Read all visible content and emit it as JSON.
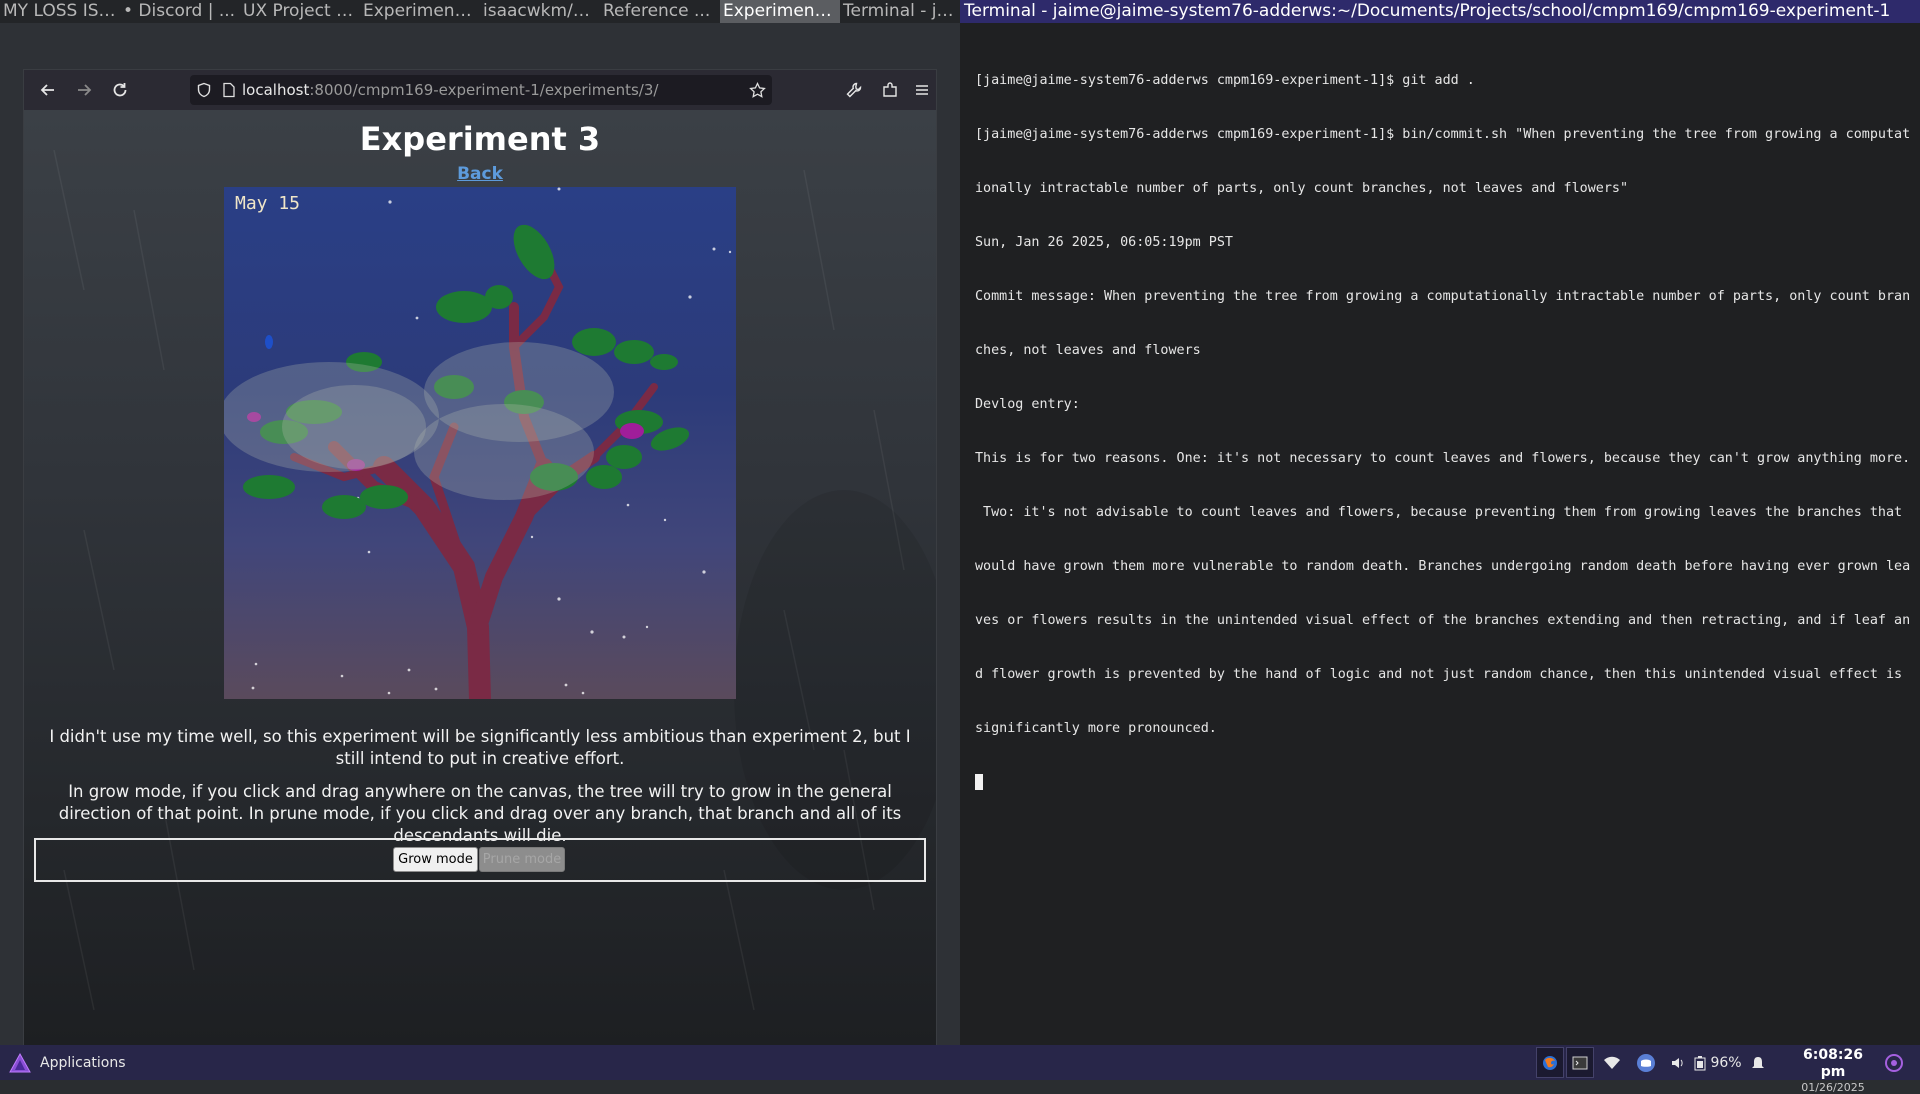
{
  "window_tabs": [
    {
      "label": "MY LOSS IS ...",
      "active": false
    },
    {
      "label": "• Discord | ...",
      "active": false
    },
    {
      "label": "UX Project P...",
      "active": false
    },
    {
      "label": "Experiment ...",
      "active": false
    },
    {
      "label": "isaacwkm/T...",
      "active": false
    },
    {
      "label": "Reference ...",
      "active": false
    },
    {
      "label": "Experiment ...",
      "active": true
    },
    {
      "label": "Terminal - ja...",
      "active": false
    }
  ],
  "terminal_title": "Terminal - jaime@jaime-system76-adderws:~/Documents/Projects/school/cmpm169/cmpm169-experiment-1",
  "browser": {
    "url_host": "localhost",
    "url_path": ":8000/cmpm169-experiment-1/experiments/3/"
  },
  "page": {
    "title": "Experiment 3",
    "back": "Back",
    "canvas_date": "May 15",
    "desc1": "I didn't use my time well, so this experiment will be significantly less ambitious than experiment 2, but I still intend to put in creative effort.",
    "desc2": "In grow mode, if you click and drag anywhere on the canvas, the tree will try to grow in the general direction of that point. In prune mode, if you click and drag over any branch, that branch and all of its descendants will die.",
    "grow_button": "Grow mode",
    "prune_button": "Prune mode"
  },
  "terminal": {
    "lines": [
      "[jaime@jaime-system76-adderws cmpm169-experiment-1]$ git add .",
      "[jaime@jaime-system76-adderws cmpm169-experiment-1]$ bin/commit.sh \"When preventing the tree from growing a computat",
      "ionally intractable number of parts, only count branches, not leaves and flowers\"",
      "Sun, Jan 26 2025, 06:05:19pm PST",
      "Commit message: When preventing the tree from growing a computationally intractable number of parts, only count bran",
      "ches, not leaves and flowers",
      "Devlog entry:",
      "This is for two reasons. One: it's not necessary to count leaves and flowers, because they can't grow anything more.",
      " Two: it's not advisable to count leaves and flowers, because preventing them from growing leaves the branches that",
      "would have grown them more vulnerable to random death. Branches undergoing random death before having ever grown lea",
      "ves or flowers results in the unintended visual effect of the branches extending and then retracting, and if leaf an",
      "d flower growth is prevented by the hand of logic and not just random chance, then this unintended visual effect is",
      "significantly more pronounced."
    ]
  },
  "panel": {
    "apps_label": "Applications",
    "battery": "96%",
    "time": "6:08:26 pm",
    "date": "01/26/2025"
  },
  "colors": {
    "panel_bg": "#282649",
    "terminal_title_bg": "#2e2a6b",
    "link": "#5d9bdc"
  }
}
